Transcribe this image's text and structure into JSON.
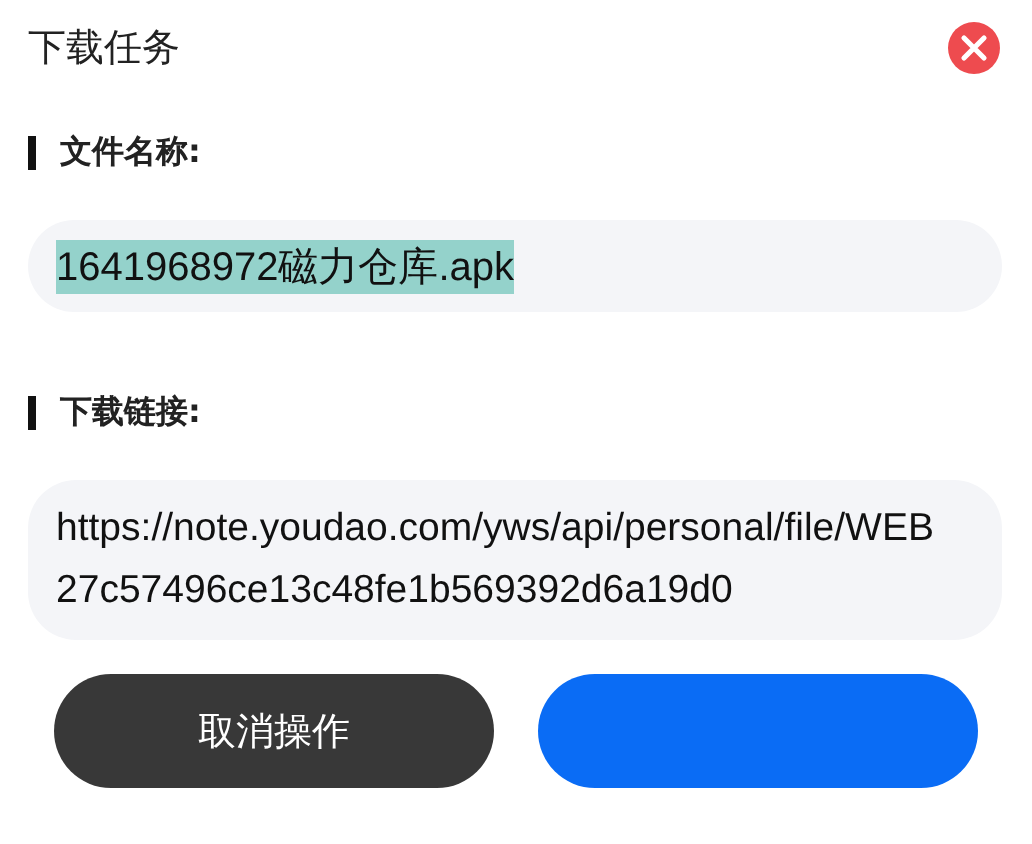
{
  "dialog": {
    "title": "下载任务"
  },
  "file_name": {
    "label": "文件名称:",
    "value": "1641968972磁力仓库.apk",
    "selected": true
  },
  "download_link": {
    "label": "下载链接:",
    "value": "https://note.youdao.com/yws/api/personal/file/WEB27c57496ce13c48fe1b569392d6a19d0"
  },
  "buttons": [
    {
      "kind": "secondary",
      "label": "取消操作"
    },
    {
      "kind": "primary"
    }
  ]
}
